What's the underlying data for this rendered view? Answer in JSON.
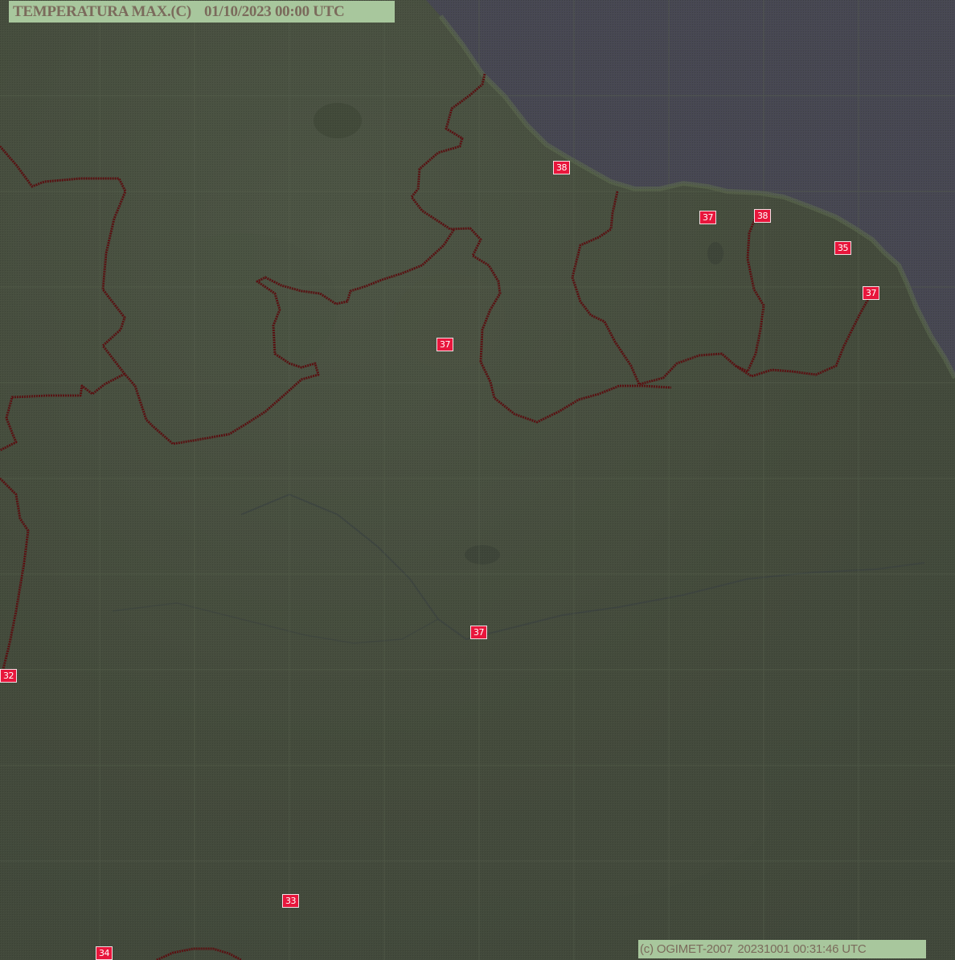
{
  "map": {
    "title": "TEMPERATURA MAX.(C)",
    "datetime": "01/10/2023 00:00 UTC",
    "credit_source": "(c) OGIMET-2007",
    "credit_timestamp": "20231001 00:31:46 UTC",
    "colors": {
      "land": "#444b3c",
      "ocean": "#474753",
      "border": "#5a0e10",
      "label_box": "#a8c79d",
      "label_text": "#7b6b5c",
      "marker": "#e8163c",
      "grid": "#55604b"
    },
    "stations": [
      {
        "id": "s1",
        "value": "38"
      },
      {
        "id": "s2",
        "value": "37"
      },
      {
        "id": "s3",
        "value": "38"
      },
      {
        "id": "s4",
        "value": "35"
      },
      {
        "id": "s5",
        "value": "37"
      },
      {
        "id": "s6",
        "value": "37"
      },
      {
        "id": "s7",
        "value": "37"
      },
      {
        "id": "s8",
        "value": "32"
      },
      {
        "id": "s9",
        "value": "33"
      },
      {
        "id": "s10",
        "value": "34"
      }
    ]
  }
}
